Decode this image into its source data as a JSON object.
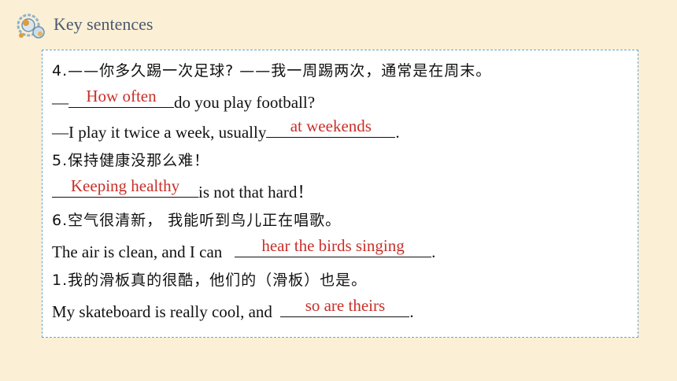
{
  "header": {
    "title": "Key sentences",
    "logo_icon": "molecule-gear-icon",
    "accent": "#4a5a70"
  },
  "colors": {
    "answer": "#c8302a",
    "card_border": "#6fa3c7",
    "background": "#fbefd5"
  },
  "items": {
    "q4_cn": "4.——你多久踢一次足球?  ——我一周踢两次，通常是在周末。",
    "q4_en1_prefix": "—",
    "q4_en1_answer": "How often",
    "q4_en1_suffix": "do you play football?",
    "q4_en2_prefix": "—I play it twice a week, usually",
    "q4_en2_answer": "at weekends",
    "q4_en2_suffix": ".",
    "q5_cn": "5.保持健康没那么难！",
    "q5_en_answer": "Keeping healthy",
    "q5_en_suffix": "is not that hard！",
    "q6_cn": "6.空气很清新， 我能听到鸟儿正在唱歌。",
    "q6_en_prefix": "The air is clean, and I can",
    "q6_en_answer": "hear the birds singing",
    "q6_en_suffix": ".",
    "q1_cn": "1.我的滑板真的很酷，他们的（滑板）也是。",
    "q1_en_prefix": "My skateboard is really cool, and",
    "q1_en_answer": "so are theirs",
    "q1_en_suffix": "."
  }
}
